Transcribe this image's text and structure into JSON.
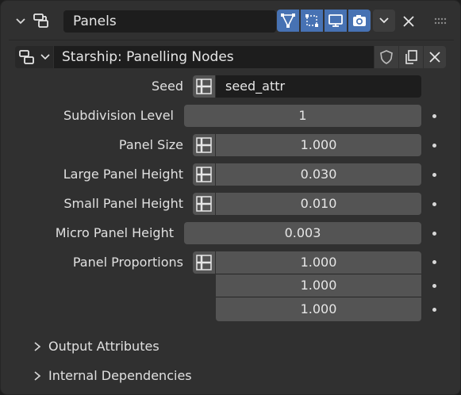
{
  "header": {
    "panel_name": "Panels",
    "icons": [
      "collapse-chevron-icon",
      "modifier-type-icon",
      "edit-mode-toggle-icon",
      "on-cage-toggle-icon",
      "realtime-toggle-icon",
      "render-toggle-icon",
      "dropdown-chevron-icon",
      "close-icon",
      "drag-handle-icon"
    ]
  },
  "node_group": {
    "name": "Starship: Panelling Nodes",
    "icons": [
      "node-tree-icon",
      "fake-user-shield-icon",
      "duplicate-icon",
      "unlink-icon"
    ]
  },
  "properties": [
    {
      "label": "Seed",
      "value": "seed_attr",
      "has_attr_toggle": true
    },
    {
      "label": "Subdivision Level",
      "value": "1",
      "has_attr_toggle": false
    },
    {
      "label": "Panel Size",
      "value": "1.000",
      "has_attr_toggle": true
    },
    {
      "label": "Large Panel Height",
      "value": "0.030",
      "has_attr_toggle": true
    },
    {
      "label": "Small Panel Height",
      "value": "0.010",
      "has_attr_toggle": true
    },
    {
      "label": "Micro Panel Height",
      "value": "0.003",
      "has_attr_toggle": false
    },
    {
      "label": "Panel Proportions",
      "values": [
        "1.000",
        "1.000",
        "1.000"
      ],
      "has_attr_toggle": true
    }
  ],
  "sections": [
    {
      "label": "Output Attributes",
      "expanded": false
    },
    {
      "label": "Internal Dependencies",
      "expanded": false
    }
  ],
  "colors": {
    "accent": "#4772b3",
    "field": "#545454",
    "background": "#303030"
  }
}
